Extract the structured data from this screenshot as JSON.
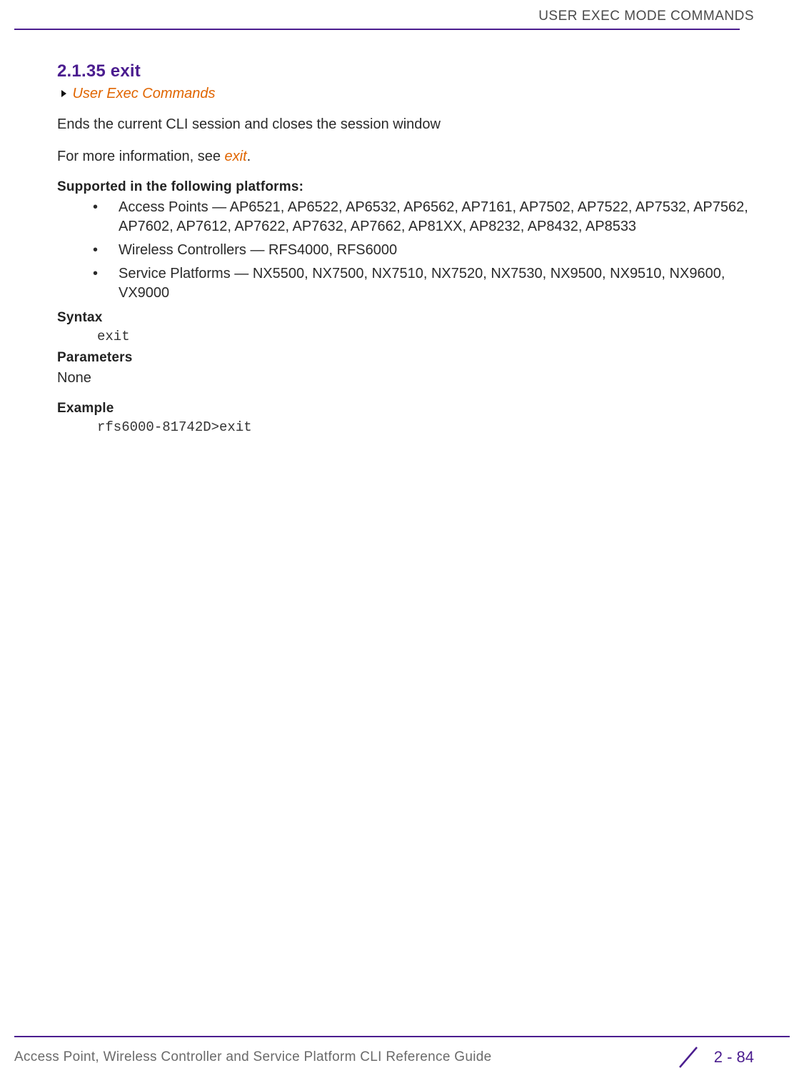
{
  "header": {
    "running_title": "USER EXEC MODE COMMANDS"
  },
  "section": {
    "heading": "2.1.35 exit",
    "breadcrumb": "User Exec Commands",
    "intro": "Ends the current CLI session and closes the session window",
    "more_info_prefix": "For more information, see ",
    "more_info_link": "exit",
    "more_info_suffix": "."
  },
  "platforms": {
    "heading": "Supported in the following platforms:",
    "items": [
      "Access Points — AP6521, AP6522, AP6532, AP6562, AP7161, AP7502, AP7522, AP7532, AP7562, AP7602, AP7612, AP7622, AP7632, AP7662, AP81XX, AP8232, AP8432, AP8533",
      "Wireless Controllers — RFS4000, RFS6000",
      "Service Platforms — NX5500, NX7500, NX7510, NX7520, NX7530, NX9500, NX9510, NX9600, VX9000"
    ]
  },
  "syntax": {
    "heading": "Syntax",
    "code": "exit"
  },
  "parameters": {
    "heading": "Parameters",
    "value": "None"
  },
  "example": {
    "heading": "Example",
    "code": "rfs6000-81742D>exit"
  },
  "footer": {
    "title": "Access Point, Wireless Controller and Service Platform CLI Reference Guide",
    "page": "2 - 84"
  }
}
